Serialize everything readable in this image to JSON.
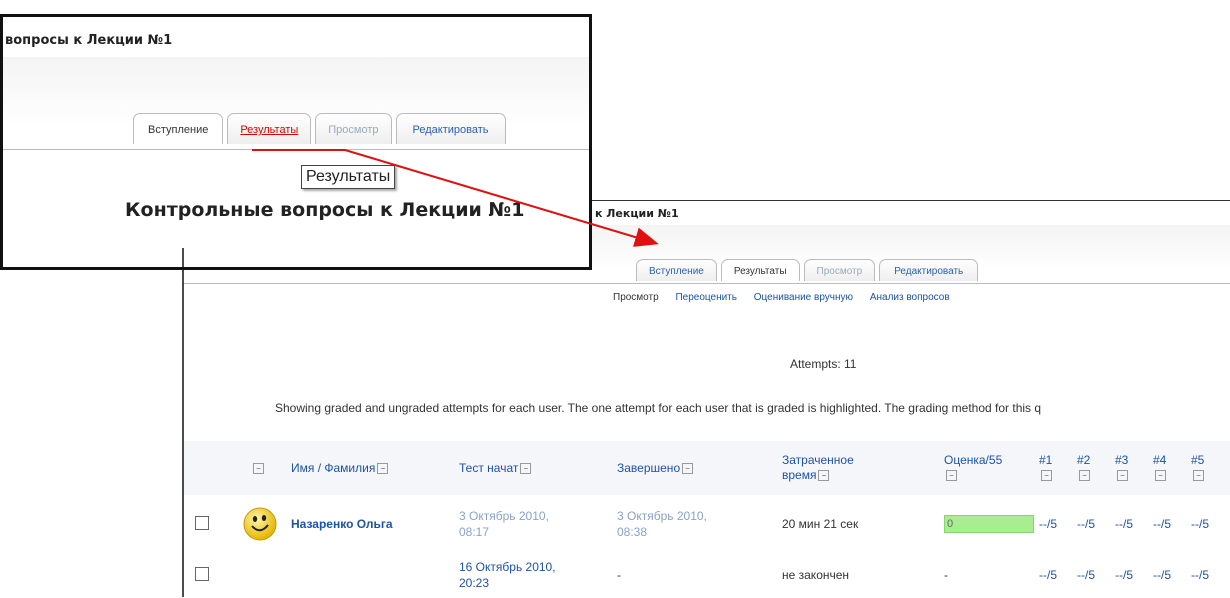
{
  "top": {
    "title": "вопросы к Лекции №1",
    "tabs": [
      "Вступление",
      "Результаты",
      "Просмотр",
      "Редактировать"
    ],
    "tooltip": "Результаты",
    "heading": "Контрольные вопросы к Лекции №1"
  },
  "main": {
    "title": "к Лекции №1",
    "tabs": [
      "Вступление",
      "Результаты",
      "Просмотр",
      "Редактировать"
    ],
    "subtabs": [
      "Просмотр",
      "Переоценить",
      "Оценивание вручную",
      "Анализ вопросов"
    ],
    "attempts": "Attempts: 11",
    "info": "Showing graded and ungraded attempts for each user. The one attempt for each user that is graded is highlighted. The grading method for this q",
    "headers": {
      "name": "Имя / Фамилия",
      "started": "Тест начат",
      "completed": "Завершено",
      "time_line1": "Затраченное",
      "time_line2": "время",
      "grade": "Оценка/55",
      "q1": "#1",
      "q2": "#2",
      "q3": "#3",
      "q4": "#4",
      "q5": "#5"
    },
    "rows": [
      {
        "name": "Назаренко Ольга",
        "start1": "3 Октябрь 2010,",
        "start2": "08:17",
        "end1": "3 Октябрь 2010,",
        "end2": "08:38",
        "time": "20 мин 21 сек",
        "grade": "0",
        "q1": "--/5",
        "q2": "--/5",
        "q3": "--/5",
        "q4": "--/5",
        "q5": "--/5"
      },
      {
        "name": "",
        "start1": "16 Октябрь 2010,",
        "start2": "20:23",
        "end": "-",
        "time": "не закончен",
        "grade": "-",
        "q1": "--/5",
        "q2": "--/5",
        "q3": "--/5",
        "q4": "--/5",
        "q5": "--/5"
      }
    ]
  },
  "colors": {
    "arrow": "#e01010",
    "grade_bar": "#a6ee8f",
    "link": "#1c53a6"
  }
}
